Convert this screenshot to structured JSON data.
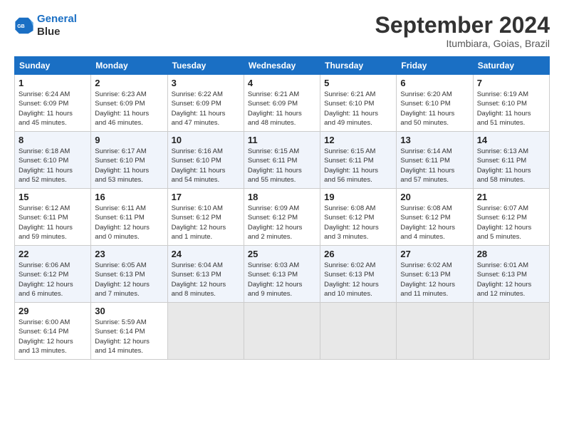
{
  "header": {
    "logo_line1": "General",
    "logo_line2": "Blue",
    "month": "September 2024",
    "location": "Itumbiara, Goias, Brazil"
  },
  "days_of_week": [
    "Sunday",
    "Monday",
    "Tuesday",
    "Wednesday",
    "Thursday",
    "Friday",
    "Saturday"
  ],
  "weeks": [
    [
      {
        "day": 1,
        "info": "Sunrise: 6:24 AM\nSunset: 6:09 PM\nDaylight: 11 hours\nand 45 minutes."
      },
      {
        "day": 2,
        "info": "Sunrise: 6:23 AM\nSunset: 6:09 PM\nDaylight: 11 hours\nand 46 minutes."
      },
      {
        "day": 3,
        "info": "Sunrise: 6:22 AM\nSunset: 6:09 PM\nDaylight: 11 hours\nand 47 minutes."
      },
      {
        "day": 4,
        "info": "Sunrise: 6:21 AM\nSunset: 6:09 PM\nDaylight: 11 hours\nand 48 minutes."
      },
      {
        "day": 5,
        "info": "Sunrise: 6:21 AM\nSunset: 6:10 PM\nDaylight: 11 hours\nand 49 minutes."
      },
      {
        "day": 6,
        "info": "Sunrise: 6:20 AM\nSunset: 6:10 PM\nDaylight: 11 hours\nand 50 minutes."
      },
      {
        "day": 7,
        "info": "Sunrise: 6:19 AM\nSunset: 6:10 PM\nDaylight: 11 hours\nand 51 minutes."
      }
    ],
    [
      {
        "day": 8,
        "info": "Sunrise: 6:18 AM\nSunset: 6:10 PM\nDaylight: 11 hours\nand 52 minutes."
      },
      {
        "day": 9,
        "info": "Sunrise: 6:17 AM\nSunset: 6:10 PM\nDaylight: 11 hours\nand 53 minutes."
      },
      {
        "day": 10,
        "info": "Sunrise: 6:16 AM\nSunset: 6:10 PM\nDaylight: 11 hours\nand 54 minutes."
      },
      {
        "day": 11,
        "info": "Sunrise: 6:15 AM\nSunset: 6:11 PM\nDaylight: 11 hours\nand 55 minutes."
      },
      {
        "day": 12,
        "info": "Sunrise: 6:15 AM\nSunset: 6:11 PM\nDaylight: 11 hours\nand 56 minutes."
      },
      {
        "day": 13,
        "info": "Sunrise: 6:14 AM\nSunset: 6:11 PM\nDaylight: 11 hours\nand 57 minutes."
      },
      {
        "day": 14,
        "info": "Sunrise: 6:13 AM\nSunset: 6:11 PM\nDaylight: 11 hours\nand 58 minutes."
      }
    ],
    [
      {
        "day": 15,
        "info": "Sunrise: 6:12 AM\nSunset: 6:11 PM\nDaylight: 11 hours\nand 59 minutes."
      },
      {
        "day": 16,
        "info": "Sunrise: 6:11 AM\nSunset: 6:11 PM\nDaylight: 12 hours\nand 0 minutes."
      },
      {
        "day": 17,
        "info": "Sunrise: 6:10 AM\nSunset: 6:12 PM\nDaylight: 12 hours\nand 1 minute."
      },
      {
        "day": 18,
        "info": "Sunrise: 6:09 AM\nSunset: 6:12 PM\nDaylight: 12 hours\nand 2 minutes."
      },
      {
        "day": 19,
        "info": "Sunrise: 6:08 AM\nSunset: 6:12 PM\nDaylight: 12 hours\nand 3 minutes."
      },
      {
        "day": 20,
        "info": "Sunrise: 6:08 AM\nSunset: 6:12 PM\nDaylight: 12 hours\nand 4 minutes."
      },
      {
        "day": 21,
        "info": "Sunrise: 6:07 AM\nSunset: 6:12 PM\nDaylight: 12 hours\nand 5 minutes."
      }
    ],
    [
      {
        "day": 22,
        "info": "Sunrise: 6:06 AM\nSunset: 6:12 PM\nDaylight: 12 hours\nand 6 minutes."
      },
      {
        "day": 23,
        "info": "Sunrise: 6:05 AM\nSunset: 6:13 PM\nDaylight: 12 hours\nand 7 minutes."
      },
      {
        "day": 24,
        "info": "Sunrise: 6:04 AM\nSunset: 6:13 PM\nDaylight: 12 hours\nand 8 minutes."
      },
      {
        "day": 25,
        "info": "Sunrise: 6:03 AM\nSunset: 6:13 PM\nDaylight: 12 hours\nand 9 minutes."
      },
      {
        "day": 26,
        "info": "Sunrise: 6:02 AM\nSunset: 6:13 PM\nDaylight: 12 hours\nand 10 minutes."
      },
      {
        "day": 27,
        "info": "Sunrise: 6:02 AM\nSunset: 6:13 PM\nDaylight: 12 hours\nand 11 minutes."
      },
      {
        "day": 28,
        "info": "Sunrise: 6:01 AM\nSunset: 6:13 PM\nDaylight: 12 hours\nand 12 minutes."
      }
    ],
    [
      {
        "day": 29,
        "info": "Sunrise: 6:00 AM\nSunset: 6:14 PM\nDaylight: 12 hours\nand 13 minutes."
      },
      {
        "day": 30,
        "info": "Sunrise: 5:59 AM\nSunset: 6:14 PM\nDaylight: 12 hours\nand 14 minutes."
      },
      null,
      null,
      null,
      null,
      null
    ]
  ]
}
